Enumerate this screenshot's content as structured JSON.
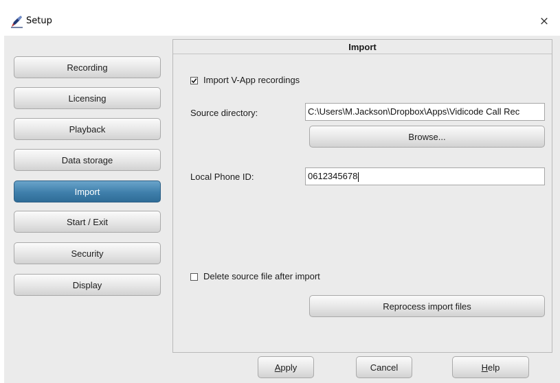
{
  "window": {
    "title": "Setup",
    "close_glyph": "×",
    "icon": "app-logo-icon"
  },
  "nav": {
    "items": [
      {
        "label": "Recording"
      },
      {
        "label": "Licensing"
      },
      {
        "label": "Playback"
      },
      {
        "label": "Data storage"
      },
      {
        "label": "Import",
        "active": true
      },
      {
        "label": "Start / Exit"
      },
      {
        "label": "Security"
      },
      {
        "label": "Display"
      }
    ]
  },
  "panel": {
    "title": "Import",
    "import_vapp": {
      "label": "Import V-App recordings",
      "checked": true
    },
    "source_directory": {
      "label": "Source directory:",
      "value": "C:\\Users\\M.Jackson\\Dropbox\\Apps\\Vidicode Call Rec"
    },
    "browse_label": "Browse...",
    "local_phone_id": {
      "label": "Local Phone ID:",
      "value": "0612345678"
    },
    "delete_source": {
      "label": "Delete source file after import",
      "checked": false
    },
    "reprocess_label": "Reprocess import files"
  },
  "footer": {
    "apply": {
      "mnemonic": "A",
      "rest": "pply"
    },
    "cancel": {
      "label": "Cancel"
    },
    "help": {
      "mnemonic": "H",
      "rest": "elp"
    }
  },
  "colors": {
    "active_nav": "#3f7fab",
    "background": "#ebebeb"
  }
}
